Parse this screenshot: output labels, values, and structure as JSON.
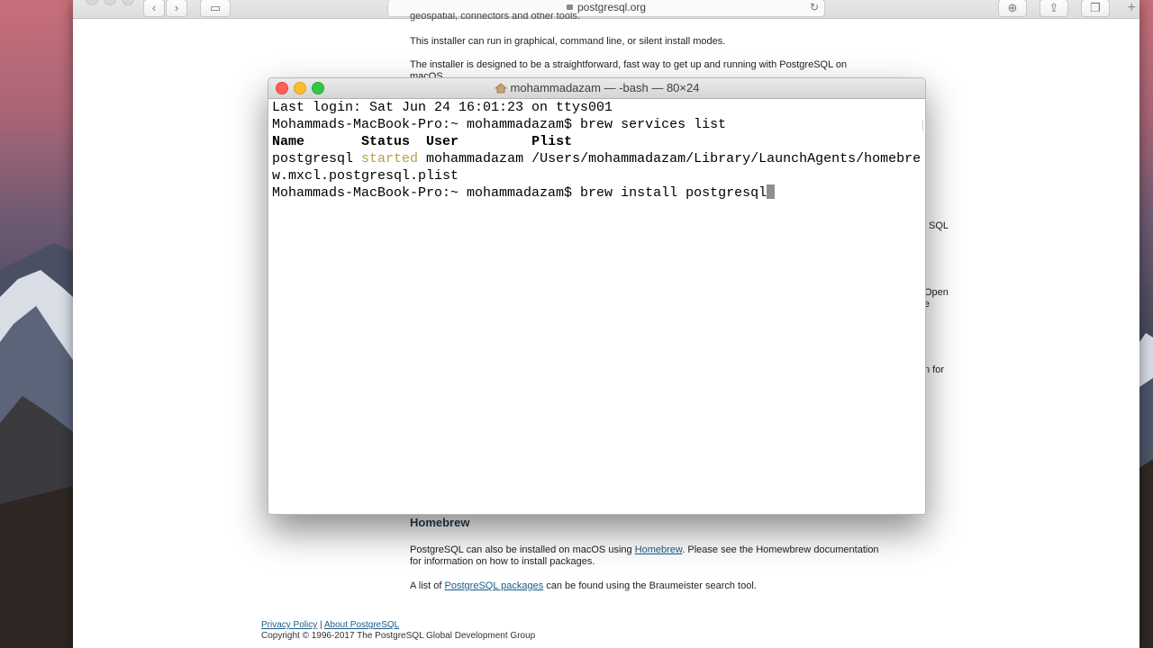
{
  "browser": {
    "address": "postgresql.org"
  },
  "page": {
    "fragment_top": "geospatial, connectors and other tools.",
    "para_modes": "This installer can run in graphical, command line, or silent install modes.",
    "para_installer": "The installer is designed to be a straightforward, fast way to get up and running with PostgreSQL on",
    "para_installer_cont": "macOS.",
    "side_fragments": [
      "SQL",
      "Open",
      "e",
      "n for"
    ],
    "homebrew_heading": "Homebrew",
    "homebrew_p1_before": "PostgreSQL can also be installed on macOS using ",
    "homebrew_p1_link": "Homebrew",
    "homebrew_p1_after": ". Please see the Homewbrew documentation",
    "homebrew_p1_line2": "for information on how to install packages.",
    "homebrew_p2_before": "A list of ",
    "homebrew_p2_link": "PostgreSQL packages",
    "homebrew_p2_after": " can be found using the Braumeister search tool.",
    "footer_privacy": "Privacy Policy",
    "footer_sep": " | ",
    "footer_about": "About PostgreSQL",
    "footer_copyright": "Copyright © 1996-2017 The PostgreSQL Global Development Group"
  },
  "terminal": {
    "title": "mohammadazam — -bash — 80×24",
    "line_login": "Last login: Sat Jun 24 16:01:23 on ttys001",
    "line_cmd1": "Mohammads-MacBook-Pro:~ mohammadazam$ brew services list",
    "hdr_name": "Name       ",
    "hdr_status": "Status  ",
    "hdr_user": "User         ",
    "hdr_plist": "Plist",
    "row_name": "postgresql ",
    "row_status": "started",
    "row_rest": " mohammadazam /Users/mohammadazam/Library/LaunchAgents/homebre",
    "row_wrap": "w.mxcl.postgresql.plist",
    "line_cmd2": "Mohammads-MacBook-Pro:~ mohammadazam$ brew install postgresql"
  },
  "colors": {
    "close": "#fc5f57",
    "minimize": "#fdbc2e",
    "zoom": "#33c748",
    "status_started": "#b7a13a",
    "link": "#1a5c86"
  }
}
